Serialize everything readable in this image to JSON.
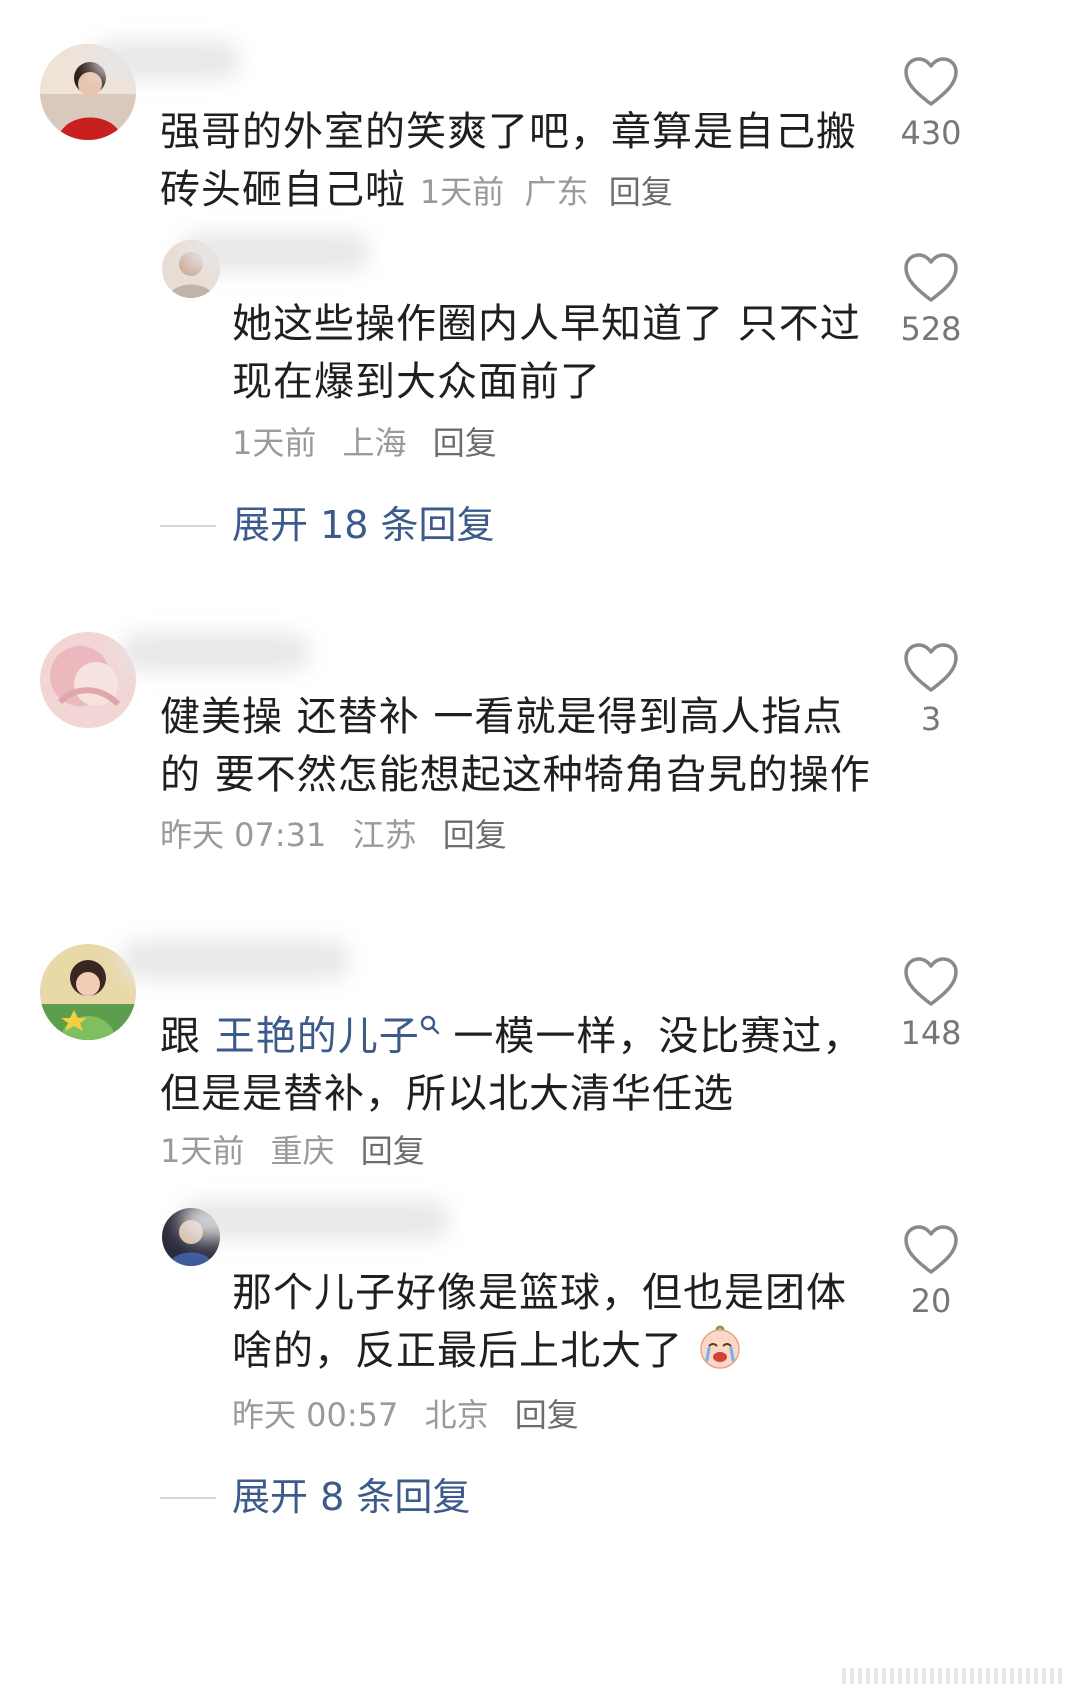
{
  "comments": [
    {
      "text_line1": "强哥的外室的笑爽了吧，章算是自己搬",
      "text_line2": "砖头砸自己啦",
      "time": "1天前",
      "location": "广东",
      "reply_label": "回复",
      "likes": "430",
      "replies": [
        {
          "text_line1": "她这些操作圈内人早知道了 只不过",
          "text_line2": "现在爆到大众面前了",
          "time": "1天前",
          "location": "上海",
          "reply_label": "回复",
          "likes": "528"
        }
      ],
      "expand_label": "展开 18 条回复"
    },
    {
      "text_line1": "健美操 还替补 一看就是得到高人指点",
      "text_line2": "的 要不然怎能想起这种犄角旮旯的操作",
      "time": "昨天 07:31",
      "location": "江苏",
      "reply_label": "回复",
      "likes": "3"
    },
    {
      "text_prefix": "跟 ",
      "link_text": "王艳的儿子",
      "text_suffix": " 一模一样，没比赛过，",
      "text_line2": "但是是替补，所以北大清华任选",
      "time": "1天前",
      "location": "重庆",
      "reply_label": "回复",
      "likes": "148",
      "replies": [
        {
          "text_line1": "那个儿子好像是篮球，但也是团体",
          "text_line2": "啥的，反正最后上北大了",
          "time": "昨天 00:57",
          "location": "北京",
          "reply_label": "回复",
          "likes": "20",
          "emoji_icon": "crying-face-icon"
        }
      ],
      "expand_label": "展开 8 条回复"
    }
  ],
  "icons": {
    "like": "heart-outline-icon",
    "search": "search-icon"
  },
  "colors": {
    "link": "#3c5a8a",
    "meta": "#9a9a9a",
    "text": "#1f1f1f",
    "like_count": "#777777"
  }
}
